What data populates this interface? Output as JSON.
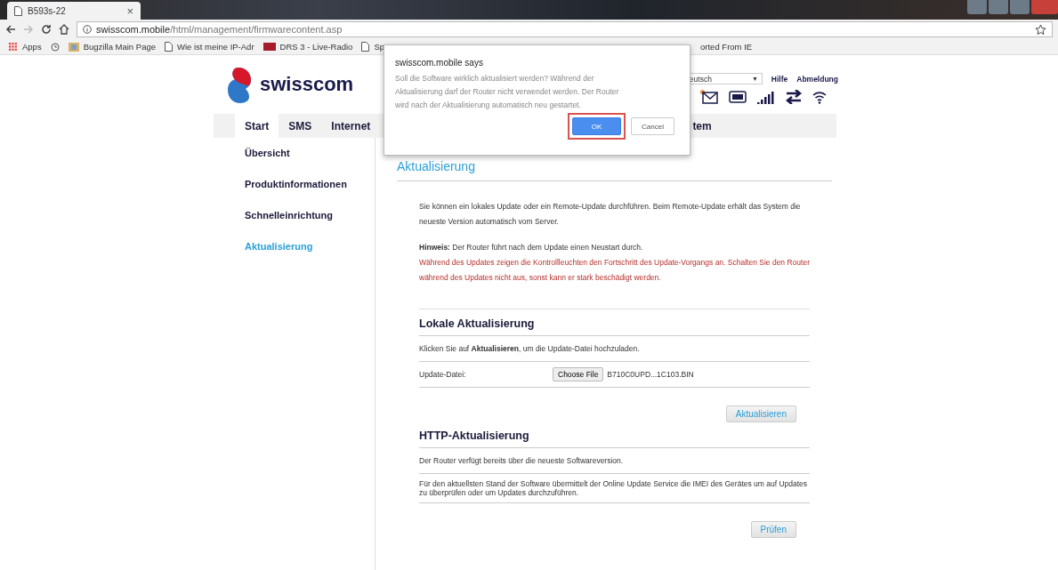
{
  "browser": {
    "tab_title": "B593s-22",
    "tab_close": "×",
    "address": {
      "host": "swisscom.mobile",
      "path": "/html/management/firmwarecontent.asp"
    },
    "bookmarks": [
      {
        "label": "Apps",
        "kind": "apps"
      },
      {
        "kind": "history"
      },
      {
        "label": "Bugzilla Main Page",
        "kind": "folder"
      },
      {
        "label": "Wie ist meine IP-Adr",
        "kind": "page"
      },
      {
        "label": "DRS 3 - Live-Radio",
        "kind": "srf"
      },
      {
        "label": "Sp",
        "kind": "page"
      },
      {
        "label": "orted From IE",
        "kind": "text"
      }
    ]
  },
  "header": {
    "brand": "swisscom",
    "language": "eutsch",
    "language_caret": "▼",
    "links": [
      "Hilfe",
      "Abmeldung"
    ]
  },
  "nav": [
    {
      "label": "Start",
      "selected": true
    },
    {
      "label": "SMS",
      "selected": false
    },
    {
      "label": "Internet",
      "selected": false
    },
    {
      "label": "tem",
      "selected": false
    }
  ],
  "sidebar": [
    {
      "label": "Übersicht",
      "selected": false
    },
    {
      "label": "Produktinformationen",
      "selected": false
    },
    {
      "label": "Schnelleinrichtung",
      "selected": false
    },
    {
      "label": "Aktualisierung",
      "selected": true
    }
  ],
  "content": {
    "heading": "Aktualisierung",
    "intro": "Sie können ein lokales Update oder ein Remote-Update durchführen. Beim Remote-Update erhält das System die neueste Version automatisch vom Server.",
    "hint": "**Hinweis:** Der Router führt nach dem Update einen Neustart durch.",
    "warning": "Während des Updates zeigen die Kontrollleuchten den Fortschritt des Update-Vorgangs an. Schalten Sie den Router während des Updates nicht aus, sonst kann er stark beschädigt werden.",
    "local": {
      "title": "Lokale Aktualisierung",
      "instruction": "Klicken Sie auf **Aktualisieren**, um die Update-Datei hochzuladen.",
      "file_label": "Update-Datei:",
      "choose_button": "Choose File",
      "file_name": "B710C0UPD...1C103.BIN",
      "button": "Aktualisieren"
    },
    "http": {
      "title": "HTTP-Aktualisierung",
      "status": "Der Router verfügt bereits über die neueste Softwareversion.",
      "info": "Für den aktuellsten Stand der Software übermittelt der Online Update Service die IMEI des Gerätes um auf Updates zu überprüfen oder um Updates durchzuführen.",
      "button": "Prüfen"
    }
  },
  "dialog": {
    "title": "swisscom.mobile says",
    "message": "Soll die Software wirklich aktualisiert werden? Während der Aktualisierung darf der Router nicht verwendet werden. Der Router wird nach der Aktualisierung automatisch neu gestartet.",
    "buttons": [
      {
        "label": "OK",
        "primary": true,
        "focused": true
      },
      {
        "label": "Cancel",
        "primary": false,
        "focused": false
      }
    ]
  }
}
